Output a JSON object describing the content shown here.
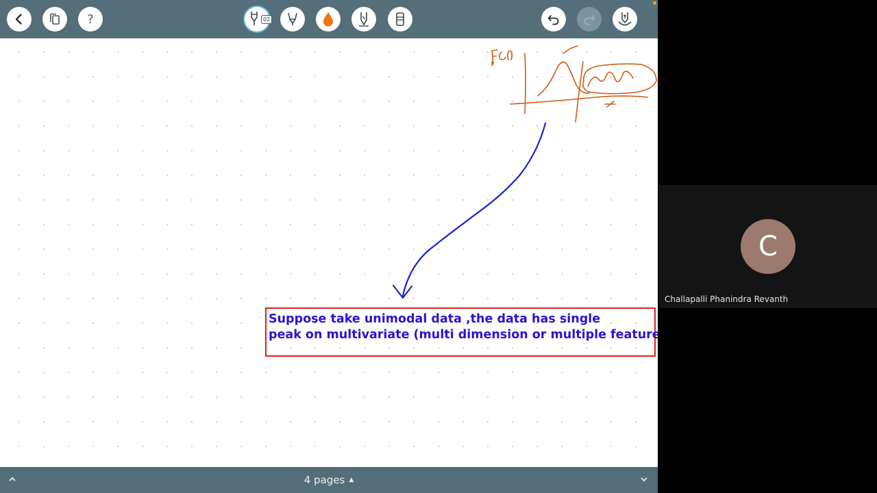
{
  "toolbar": {
    "left_buttons": [
      "back-icon",
      "pages-copy-icon",
      "help-icon"
    ],
    "help_label": "?",
    "pen_badge": "02",
    "tools": [
      "pen-icon",
      "highlighter-icon",
      "color-drop-icon",
      "pencil-icon",
      "eraser-icon"
    ],
    "active_color": "#f2750f",
    "right_buttons": [
      "undo-icon",
      "redo-icon",
      "hand-gesture-icon"
    ]
  },
  "canvas": {
    "sketch_color": "#d05a14",
    "arrow_color": "#1c1ed6",
    "textbox": {
      "line1": "Suppose take unimodal data ,the data has single",
      "line2": "peak on multivariate (multi dimension or multiple features)",
      "text_color": "#2a13d6",
      "border_color": "#e01f25"
    }
  },
  "footer": {
    "page_count": "4 pages",
    "caret": "▲"
  },
  "participant": {
    "initial": "C",
    "name": "Challapalli Phanindra Revanth",
    "avatar_color": "#9c7b6e"
  }
}
